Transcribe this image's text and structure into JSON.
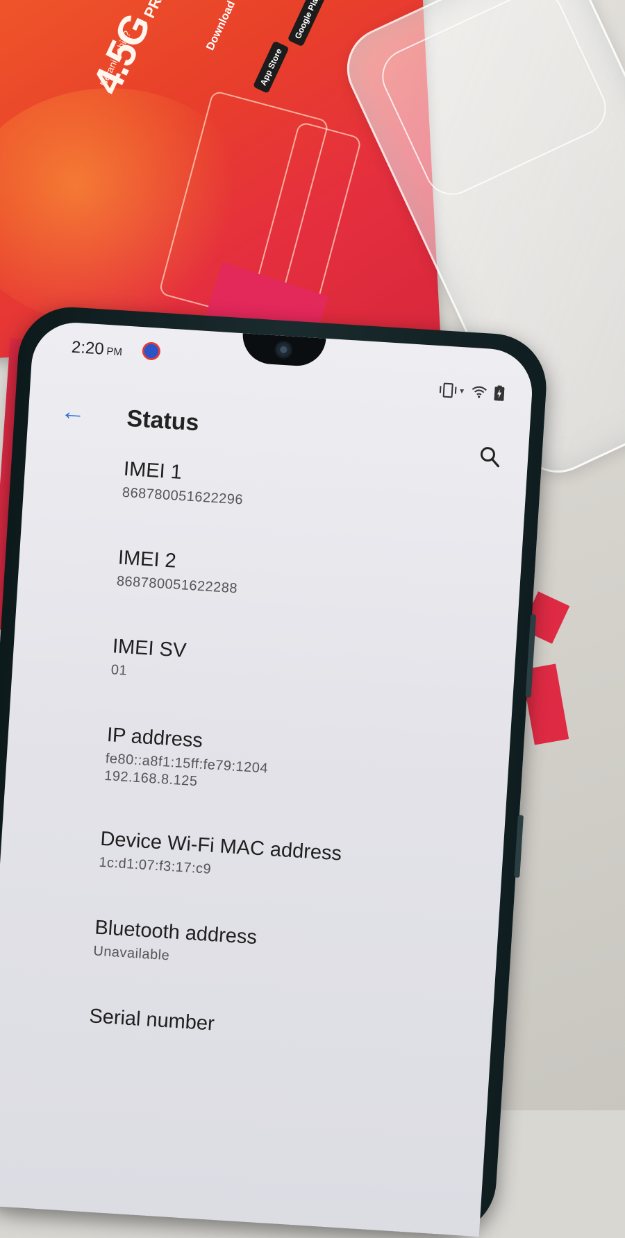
{
  "background": {
    "pack_logo": "4.5G",
    "pack_logo_sub": "PRO",
    "pack_slogan": "Berani Lebih?",
    "pack_download": "Download",
    "badge_appstore": "App Store",
    "badge_google": "Google Play",
    "colors": {
      "pack": "#e8402a",
      "pink": "#e3285a",
      "desk": "#d9d7d2"
    }
  },
  "status_bar": {
    "time": "2:20",
    "ampm": "PM"
  },
  "app_bar": {
    "title": "Status"
  },
  "items": [
    {
      "title": "IMEI 1",
      "value": "868780051622296"
    },
    {
      "title": "IMEI 2",
      "value": "868780051622288"
    },
    {
      "title": "IMEI SV",
      "value": "01"
    },
    {
      "title": "IP address",
      "value": "fe80::a8f1:15ff:fe79:1204",
      "value2": "192.168.8.125"
    },
    {
      "title": "Device Wi-Fi MAC address",
      "value": "1c:d1:07:f3:17:c9"
    },
    {
      "title": "Bluetooth address",
      "value": "Unavailable"
    },
    {
      "title": "Serial number"
    }
  ],
  "colors": {
    "accent": "#2f6fe0",
    "screen_bg": "#e6e6ec",
    "text": "#1f1f1f"
  }
}
